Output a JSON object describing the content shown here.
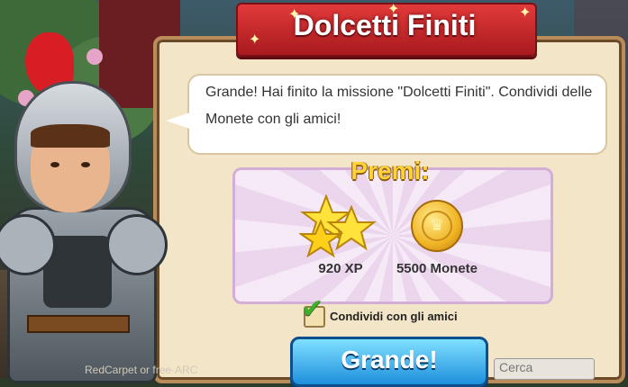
{
  "dialog": {
    "title": "Dolcetti Finiti",
    "message": "Grande! Hai finito la missione \"Dolcetti Finiti\". Condividi delle Monete con gli amici!",
    "rewards_heading": "Premi:",
    "rewards": [
      {
        "icon": "star-icon",
        "label": "920 XP"
      },
      {
        "icon": "coin-icon",
        "label": "5500 Monete"
      }
    ],
    "share_checkbox": {
      "label": "Condividi con gli amici",
      "checked": true
    },
    "confirm_button": "Grande!"
  },
  "background": {
    "bottom_text": "RedCarpet or free-ARC",
    "search_placeholder": "Cerca"
  },
  "colors": {
    "ribbon": "#c8202a",
    "panel": "#f3e6c8",
    "rewards_bg": "#f1dff2",
    "button": "#2a9ae8",
    "premi_text": "#ffd23a"
  }
}
